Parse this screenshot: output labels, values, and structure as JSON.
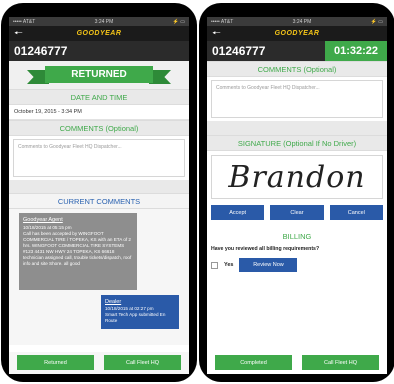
{
  "left": {
    "status": {
      "carrier": "••••• AT&T",
      "time": "3:24 PM",
      "battery": "⚡ ▭"
    },
    "brand": "GOODYEAR",
    "order_number": "01246777",
    "status_ribbon": "RETURNED",
    "date_section_title": "DATE AND TIME",
    "date_value": "October 19, 2015 - 3:34 PM",
    "comments_title": "COMMENTS (Optional)",
    "comments_placeholder": "Comments to Goodyear Fleet HQ Dispatcher...",
    "current_comments_title": "CURRENT COMMENTS",
    "agent_comment": {
      "author": "Goodyear Agent",
      "timestamp": "10/18/2015 at 05:15 pm",
      "text": "Call has been accepted by WINGFOOT COMMERCIAL TIRE / TOPEKA, KS with an ETA of 2 hrs. WINGFOOT COMMERCIAL TIRE SYSTEMS #123 4431 NW HWY 24 TOPEKA, KS 66618 technician assigned call, trouble tickets/dispatch, roof info and site Shore. all good"
    },
    "dealer_comment": {
      "author": "Dealer",
      "timestamp": "10/18/2015 at 02:27 pm",
      "text": "Smart Tech App submitted En Route"
    },
    "buttons": {
      "returned": "Returned",
      "call": "Call Fleet HQ"
    }
  },
  "right": {
    "status": {
      "carrier": "••••• AT&T",
      "time": "3:24 PM",
      "battery": "⚡ ▭"
    },
    "brand": "GOODYEAR",
    "order_number": "01246777",
    "timer": "01:32:22",
    "comments_title": "COMMENTS (Optional)",
    "comments_placeholder": "Comments to Goodyear Fleet HQ Dispatcher...",
    "signature_title": "SIGNATURE (Optional If No Driver)",
    "signature_value": "Brandon",
    "sig_buttons": {
      "accept": "Accept",
      "clear": "Clear",
      "cancel": "Cancel"
    },
    "billing_title": "BILLING",
    "billing_question": "Have you reviewed all billing requirements?",
    "yes_label": "Yes",
    "review_button": "Review Now",
    "buttons": {
      "completed": "Completed",
      "call": "Call Fleet HQ"
    }
  },
  "colors": {
    "accent_green": "#3fa94a",
    "accent_blue": "#2a5aa8",
    "brand_yellow": "#f5c518"
  }
}
